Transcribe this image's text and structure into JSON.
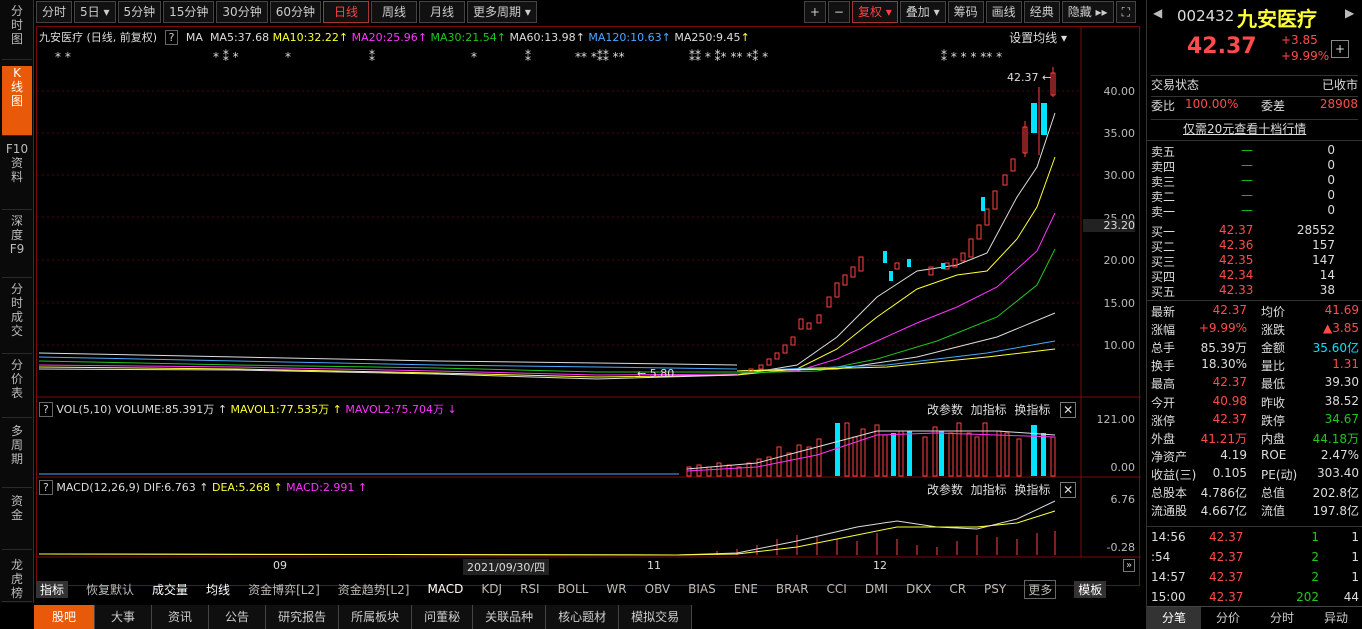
{
  "left_nav": [
    "分时图",
    "K线图",
    "F10资料",
    "深度F9",
    "分时成交",
    "分价表",
    "多周期",
    "资金",
    "龙虎榜"
  ],
  "toolbar": [
    "分时",
    "5日",
    "5分钟",
    "15分钟",
    "30分钟",
    "60分钟",
    "日线",
    "周线",
    "月线",
    "更多周期"
  ],
  "toolbar_right": [
    "+",
    "−",
    "复权",
    "叠加",
    "筹码",
    "画线",
    "经典",
    "隐藏"
  ],
  "title_line": {
    "name": "九安医疗",
    "mode": "(日线, 前复权)",
    "ma": "MA",
    "ma5": "MA5:37.68",
    "ma10": "MA10:32.22",
    "ma20": "MA20:25.96",
    "ma30": "MA30:21.54",
    "ma60": "MA60:13.98",
    "ma120": "MA120:10.63",
    "ma250": "MA250:9.45",
    "set": "设置均线"
  },
  "price_axis": [
    "40.00",
    "35.00",
    "30.00",
    "25.00",
    "20.00",
    "15.00",
    "10.00"
  ],
  "current_price_label": "23.20",
  "high_label": "42.37",
  "low_label": "5.80",
  "vol_line": {
    "label": "VOL(5,10)",
    "volume": "VOLUME:85.391万",
    "mavol1": "MAVOL1:77.535万",
    "mavol2": "MAVOL2:75.704万",
    "p1": "改参数",
    "p2": "加指标",
    "p3": "换指标",
    "ax1": "121.00",
    "ax2": "0.00"
  },
  "macd_line": {
    "label": "MACD(12,26,9)",
    "dif": "DIF:6.763",
    "dea": "DEA:5.268",
    "macd": "MACD:2.991",
    "ax1": "6.76",
    "ax2": "-0.28"
  },
  "x_axis": [
    "09",
    "2021/09/30/四",
    "11",
    "12"
  ],
  "bottom_indicators": [
    "指标",
    "恢复默认",
    "成交量",
    "均线",
    "资金博弈[L2]",
    "资金趋势[L2]",
    "MACD",
    "KDJ",
    "RSI",
    "BOLL",
    "WR",
    "OBV",
    "BIAS",
    "ENE",
    "BRAR",
    "CCI",
    "DMI",
    "DKX",
    "CR",
    "PSY",
    "更多",
    "模板"
  ],
  "tabs": [
    "股吧",
    "大事",
    "资讯",
    "公告",
    "研究报告",
    "所属板块",
    "问董秘",
    "关联品种",
    "核心题材",
    "模拟交易"
  ],
  "quote": {
    "code": "002432",
    "name": "九安医疗",
    "price": "42.37",
    "chg": "+3.85",
    "pct": "+9.99%",
    "status_k": "交易状态",
    "status_v": "已收市",
    "wb_k": "委比",
    "wb_v": "100.00%",
    "wc_k": "委差",
    "wc_v": "28908",
    "promo": "仅需20元查看十档行情",
    "sells": [
      [
        "卖五",
        "—",
        "0"
      ],
      [
        "卖四",
        "—",
        "0"
      ],
      [
        "卖三",
        "—",
        "0"
      ],
      [
        "卖二",
        "—",
        "0"
      ],
      [
        "卖一",
        "—",
        "0"
      ]
    ],
    "buys": [
      [
        "买一",
        "42.37",
        "28552"
      ],
      [
        "买二",
        "42.36",
        "157"
      ],
      [
        "买三",
        "42.35",
        "147"
      ],
      [
        "买四",
        "42.34",
        "14"
      ],
      [
        "买五",
        "42.33",
        "38"
      ]
    ],
    "stats": [
      [
        "最新",
        "42.37",
        "均价",
        "41.69"
      ],
      [
        "涨幅",
        "+9.99%",
        "涨跌",
        "▲3.85"
      ],
      [
        "总手",
        "85.39万",
        "金额",
        "35.60亿"
      ],
      [
        "换手",
        "18.30%",
        "量比",
        "1.31"
      ],
      [
        "最高",
        "42.37",
        "最低",
        "39.30"
      ],
      [
        "今开",
        "40.98",
        "昨收",
        "38.52"
      ],
      [
        "涨停",
        "42.37",
        "跌停",
        "34.67"
      ],
      [
        "外盘",
        "41.21万",
        "内盘",
        "44.18万"
      ],
      [
        "净资产",
        "4.19",
        "ROE",
        "2.47%"
      ],
      [
        "收益(三)",
        "0.105",
        "PE(动)",
        "303.40"
      ],
      [
        "总股本",
        "4.786亿",
        "总值",
        "202.8亿"
      ],
      [
        "流通股",
        "4.667亿",
        "流值",
        "197.8亿"
      ]
    ],
    "ticks": [
      [
        "14:56",
        "42.37",
        "1",
        "1"
      ],
      [
        ":54",
        "42.37",
        "2",
        "1"
      ],
      [
        "14:57",
        "42.37",
        "2",
        "1"
      ],
      [
        "15:00",
        "42.37",
        "202",
        "44"
      ]
    ],
    "btabs": [
      "分笔",
      "分价",
      "分时",
      "异动"
    ]
  }
}
